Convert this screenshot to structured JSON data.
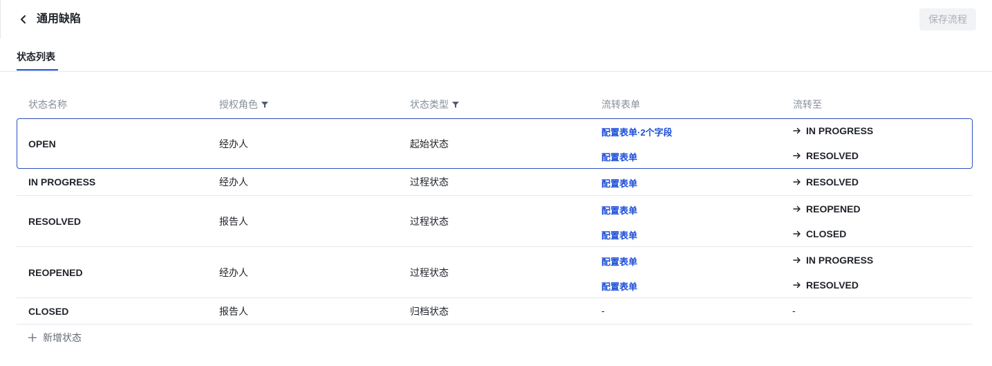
{
  "header": {
    "title": "通用缺陷",
    "save_label": "保存流程"
  },
  "tabs": [
    {
      "label": "状态列表",
      "active": true
    }
  ],
  "table": {
    "columns": [
      "状态名称",
      "授权角色",
      "状态类型",
      "流转表单",
      "流转至"
    ],
    "rows": [
      {
        "name": "OPEN",
        "role": "经办人",
        "type": "起始状态",
        "forms": [
          "配置表单·2个字段",
          "配置表单"
        ],
        "targets": [
          "IN PROGRESS",
          "RESOLVED"
        ],
        "selected": true
      },
      {
        "name": "IN PROGRESS",
        "role": "经办人",
        "type": "过程状态",
        "forms": [
          "配置表单"
        ],
        "targets": [
          "RESOLVED"
        ]
      },
      {
        "name": "RESOLVED",
        "role": "报告人",
        "type": "过程状态",
        "forms": [
          "配置表单",
          "配置表单"
        ],
        "targets": [
          "REOPENED",
          "CLOSED"
        ]
      },
      {
        "name": "REOPENED",
        "role": "经办人",
        "type": "过程状态",
        "forms": [
          "配置表单",
          "配置表单"
        ],
        "targets": [
          "IN PROGRESS",
          "RESOLVED"
        ]
      },
      {
        "name": "CLOSED",
        "role": "报告人",
        "type": "归档状态",
        "forms_empty": "-",
        "targets_empty": "-"
      }
    ]
  },
  "add_status_label": "新增状态",
  "icons": {
    "back": "chevron-left-icon",
    "filter": "filter-icon",
    "arrow": "arrow-right-icon",
    "plus": "plus-icon"
  },
  "colors": {
    "accent": "#1d4ed8",
    "selected_border": "#2b4fbf",
    "muted_text": "#86909c",
    "disabled_button_bg": "#f2f3f5",
    "disabled_button_text": "#a9aeb8"
  }
}
